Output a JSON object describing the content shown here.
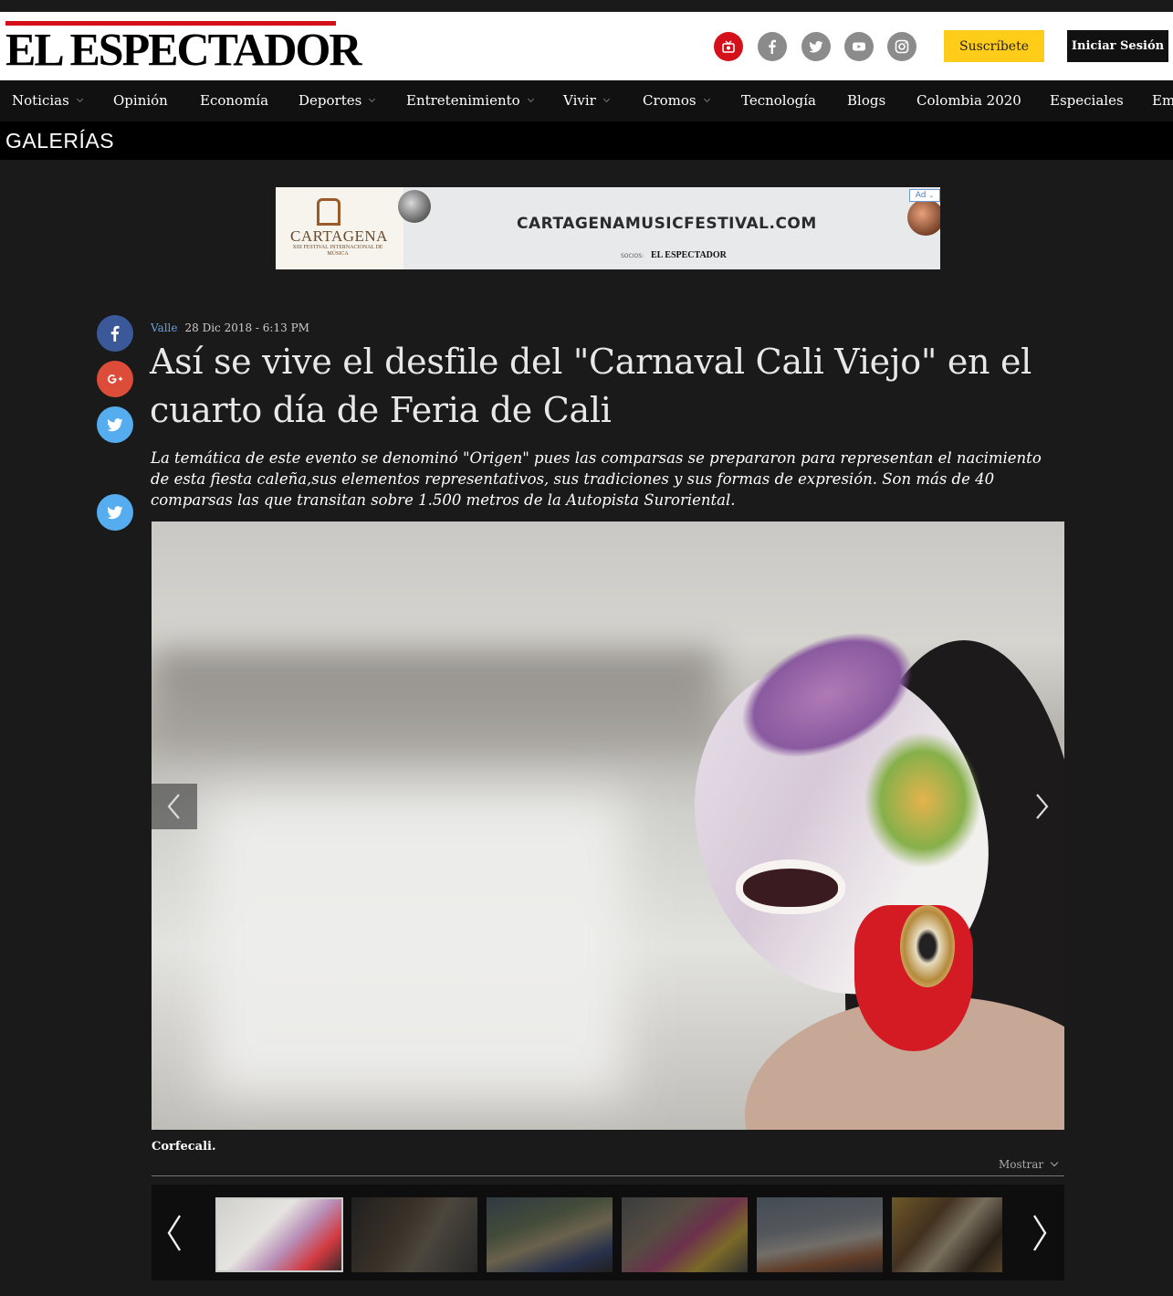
{
  "header": {
    "logo_text": "EL ESPECTADOR",
    "subscribe_label": "Suscríbete",
    "login_label": "Iniciar Sesión",
    "social_icons": [
      "tv-icon",
      "facebook-icon",
      "twitter-icon",
      "youtube-icon",
      "instagram-icon"
    ],
    "brand_red": "#d4111a",
    "subscribe_color": "#ffcc1a"
  },
  "nav": {
    "items": [
      {
        "label": "Noticias",
        "dropdown": true
      },
      {
        "label": "Opinión",
        "dropdown": false
      },
      {
        "label": "Economía",
        "dropdown": false
      },
      {
        "label": "Deportes",
        "dropdown": true
      },
      {
        "label": "Entretenimiento",
        "dropdown": true
      },
      {
        "label": "Vivir",
        "dropdown": true
      },
      {
        "label": "Cromos",
        "dropdown": true
      },
      {
        "label": "Tecnología",
        "dropdown": false
      },
      {
        "label": "Blogs",
        "dropdown": false
      },
      {
        "label": "Colombia 2020",
        "dropdown": false
      },
      {
        "label": "Especiales",
        "dropdown": false
      },
      {
        "label": "Em",
        "dropdown": false
      }
    ]
  },
  "section": {
    "title": "GALERÍAS"
  },
  "ad": {
    "brand_name": "CARTAGENA",
    "brand_sub": "XIII FESTIVAL INTERNACIONAL DE MÚSICA",
    "url": "CARTAGENAMUSICFESTIVAL.COM",
    "socios_label": "SOCIOS:",
    "sponsor": "EL ESPECTADOR",
    "badge": "Ad"
  },
  "article": {
    "category": "Valle",
    "date": "28 Dic 2018 - 6:13 PM",
    "title": "Así se vive el desfile del \"Carnaval Cali Viejo\" en el cuarto día de Feria de Cali",
    "lede": "La temática de este evento se denominó \"Origen\" pues las comparsas se prepararon para representan el nacimiento de esta fiesta caleña,sus elementos representativos, sus tradiciones y sus formas de expresión. Son más de 40 comparsas las que transitan sobre 1.500 metros de la Autopista Suroriental.",
    "share_icons": [
      "facebook-icon",
      "google-plus-icon",
      "twitter-icon",
      "twitter-icon"
    ]
  },
  "gallery": {
    "caption": "Corfecali.",
    "toggle_label": "Mostrar",
    "thumbnail_count": 6,
    "active_thumbnail": 1
  }
}
